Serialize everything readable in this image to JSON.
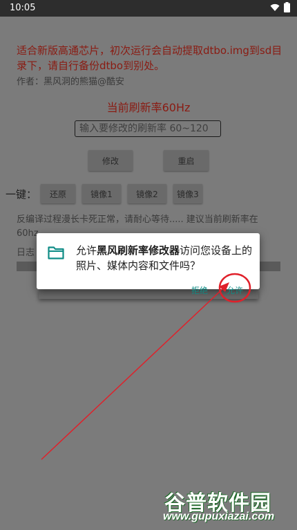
{
  "status_bar": {
    "time": "10:05",
    "wifi_icon": "wifi-icon",
    "battery_icon": "battery-icon"
  },
  "app": {
    "notice": "适合新版高通芯片，初次运行会自动提取dtbo.img到sd目录下，请自行备份dtbo到别处。",
    "author": "作者：黑风洞的熊猫@酷安",
    "current_rate": "当前刷新率60Hz",
    "rate_input_placeholder": "输入要修改的刷新率 60~120",
    "modify_label": "修改",
    "reboot_label": "重启",
    "one_key_label": "一键：",
    "one_key_buttons": [
      "还原",
      "镜像1",
      "镜像2",
      "镜像3"
    ],
    "hint": "反编译过程漫长卡死正常，请耐心等待..... 建议当前刷新率在60hz",
    "log_label": "日志"
  },
  "dialog": {
    "prefix": "允许",
    "app_name": "黑风刷新率修改器",
    "suffix": "访问您设备上的照片、媒体内容和文件吗？",
    "deny_label": "拒绝",
    "allow_label": "允许",
    "icon": "folder-icon"
  },
  "watermark": {
    "brand": "谷普软件园",
    "url": "www.gupuxiazai.com"
  },
  "colors": {
    "accent": "#0f8c86",
    "notice_red": "#8a1b12",
    "annotation_red": "#e0202a"
  }
}
